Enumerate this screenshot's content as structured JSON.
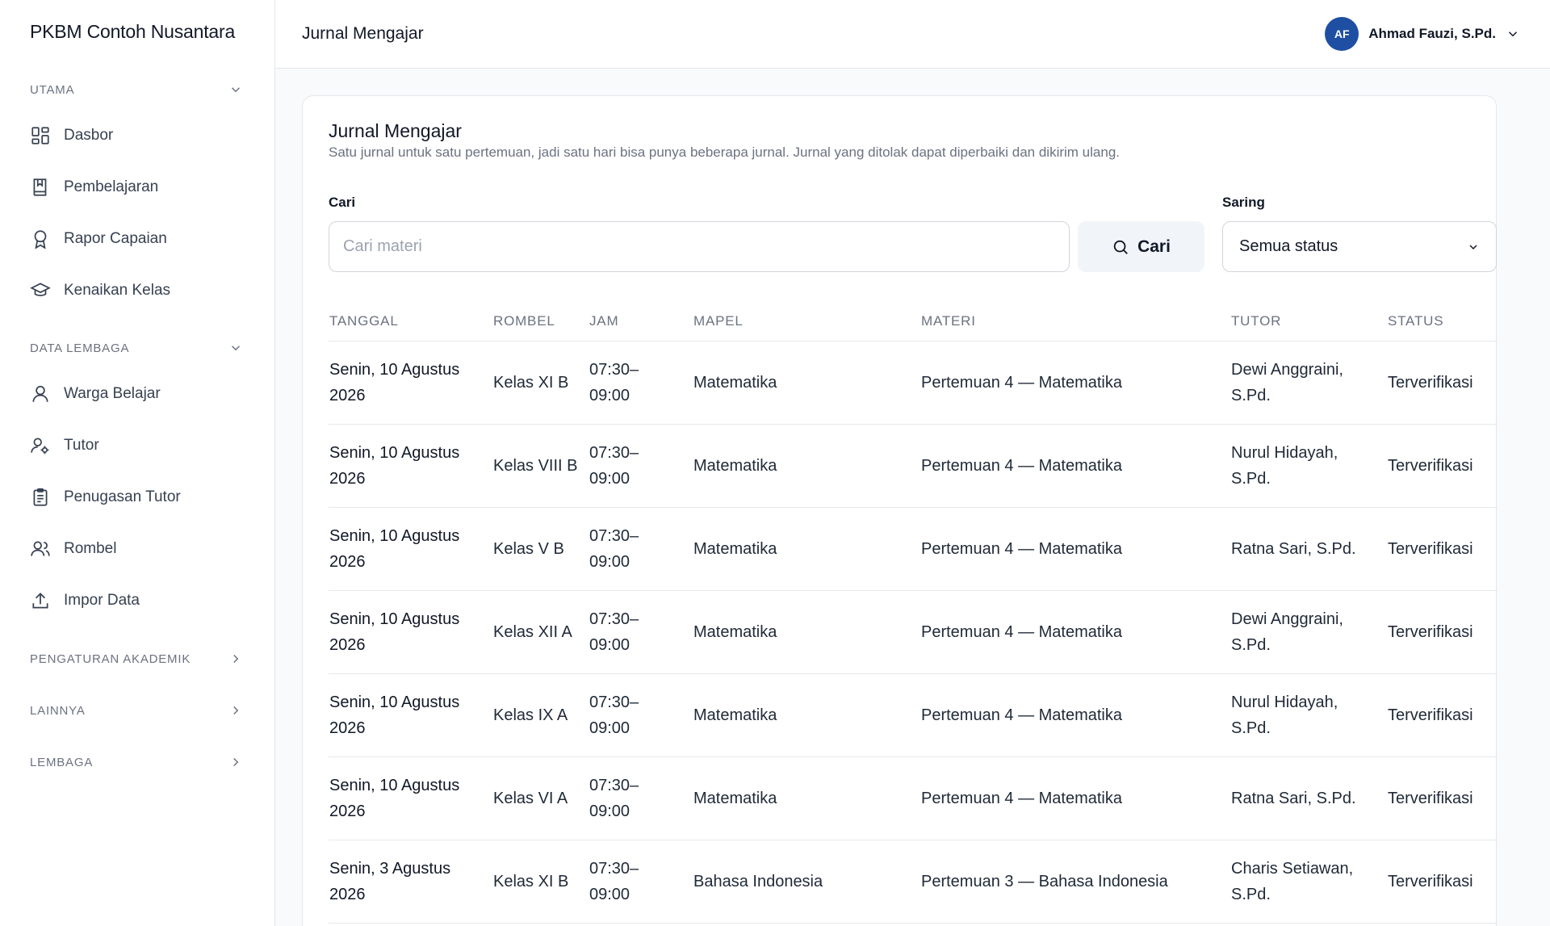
{
  "brand": "PKBM Contoh Nusantara",
  "sidebar": {
    "sections": [
      {
        "label": "UTAMA",
        "expanded": true
      },
      {
        "label": "DATA LEMBAGA",
        "expanded": true
      },
      {
        "label": "PENGATURAN AKADEMIK",
        "expanded": false
      },
      {
        "label": "LAINNYA",
        "expanded": false
      },
      {
        "label": "LEMBAGA",
        "expanded": false
      }
    ],
    "utama_items": [
      {
        "label": "Dasbor",
        "icon": "dashboard-icon"
      },
      {
        "label": "Pembelajaran",
        "icon": "book-icon"
      },
      {
        "label": "Rapor Capaian",
        "icon": "award-icon"
      },
      {
        "label": "Kenaikan Kelas",
        "icon": "graduation-cap-icon"
      }
    ],
    "lembaga_items": [
      {
        "label": "Warga Belajar",
        "icon": "user-icon"
      },
      {
        "label": "Tutor",
        "icon": "user-cog-icon"
      },
      {
        "label": "Penugasan Tutor",
        "icon": "clipboard-icon"
      },
      {
        "label": "Rombel",
        "icon": "users-icon"
      },
      {
        "label": "Impor Data",
        "icon": "upload-icon"
      }
    ]
  },
  "header": {
    "title": "Jurnal Mengajar",
    "user": {
      "initials": "AF",
      "name": "Ahmad Fauzi, S.Pd."
    }
  },
  "card": {
    "title": "Jurnal Mengajar",
    "subtitle": "Satu jurnal untuk satu pertemuan, jadi satu hari bisa punya beberapa jurnal. Jurnal yang ditolak dapat diperbaiki dan dikirim ulang.",
    "search_label": "Cari",
    "search_placeholder": "Cari materi",
    "search_button": "Cari",
    "filter_label": "Saring",
    "filter_value": "Semua status"
  },
  "table": {
    "columns": [
      "TANGGAL",
      "ROMBEL",
      "JAM",
      "MAPEL",
      "MATERI",
      "TUTOR",
      "STATUS"
    ],
    "rows": [
      {
        "tanggal": "Senin, 10 Agustus 2026",
        "rombel": "Kelas XI B",
        "jam": "07:30–09:00",
        "mapel": "Matematika",
        "materi": "Pertemuan 4 — Matematika",
        "tutor": "Dewi Anggraini, S.Pd.",
        "status": "Terverifikasi"
      },
      {
        "tanggal": "Senin, 10 Agustus 2026",
        "rombel": "Kelas VIII B",
        "jam": "07:30–09:00",
        "mapel": "Matematika",
        "materi": "Pertemuan 4 — Matematika",
        "tutor": "Nurul Hidayah, S.Pd.",
        "status": "Terverifikasi"
      },
      {
        "tanggal": "Senin, 10 Agustus 2026",
        "rombel": "Kelas V B",
        "jam": "07:30–09:00",
        "mapel": "Matematika",
        "materi": "Pertemuan 4 — Matematika",
        "tutor": "Ratna Sari, S.Pd.",
        "status": "Terverifikasi"
      },
      {
        "tanggal": "Senin, 10 Agustus 2026",
        "rombel": "Kelas XII A",
        "jam": "07:30–09:00",
        "mapel": "Matematika",
        "materi": "Pertemuan 4 — Matematika",
        "tutor": "Dewi Anggraini, S.Pd.",
        "status": "Terverifikasi"
      },
      {
        "tanggal": "Senin, 10 Agustus 2026",
        "rombel": "Kelas IX A",
        "jam": "07:30–09:00",
        "mapel": "Matematika",
        "materi": "Pertemuan 4 — Matematika",
        "tutor": "Nurul Hidayah, S.Pd.",
        "status": "Terverifikasi"
      },
      {
        "tanggal": "Senin, 10 Agustus 2026",
        "rombel": "Kelas VI A",
        "jam": "07:30–09:00",
        "mapel": "Matematika",
        "materi": "Pertemuan 4 — Matematika",
        "tutor": "Ratna Sari, S.Pd.",
        "status": "Terverifikasi"
      },
      {
        "tanggal": "Senin, 3 Agustus 2026",
        "rombel": "Kelas XI B",
        "jam": "07:30–09:00",
        "mapel": "Bahasa Indonesia",
        "materi": "Pertemuan 3 — Bahasa Indonesia",
        "tutor": "Charis Setiawan, S.Pd.",
        "status": "Terverifikasi"
      }
    ]
  },
  "colors": {
    "accent": "#1e4fa3",
    "border": "#e5e7eb",
    "muted": "#6b7280"
  }
}
